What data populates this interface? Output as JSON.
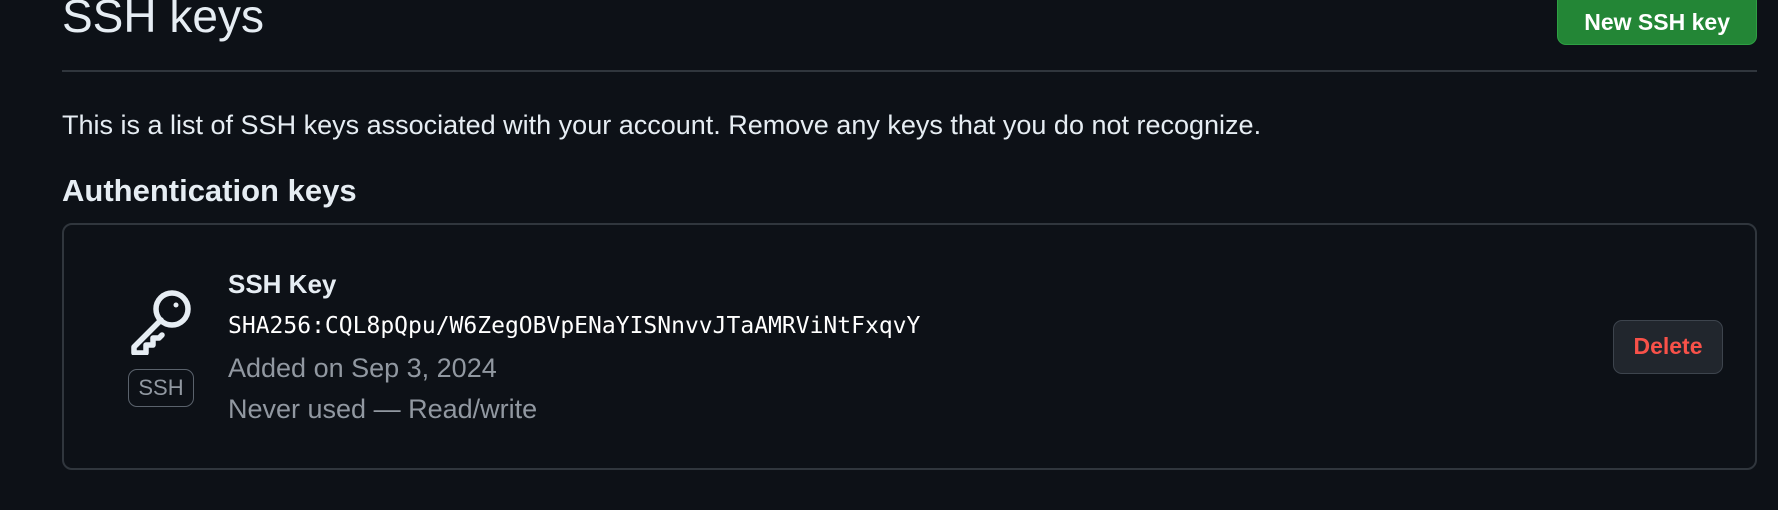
{
  "header": {
    "title": "SSH keys",
    "new_key_label": "New SSH key"
  },
  "description": "This is a list of SSH keys associated with your account. Remove any keys that you do not recognize.",
  "section": {
    "title": "Authentication keys"
  },
  "keys": [
    {
      "icon": "key-icon",
      "type_badge": "SSH",
      "title": "SSH Key",
      "fingerprint": "SHA256:CQL8pQpu/W6ZegOBVpENaYISNnvvJTaAMRViNtFxqvY",
      "added": "Added on Sep 3, 2024",
      "usage": "Never used — Read/write",
      "delete_label": "Delete"
    }
  ],
  "colors": {
    "background": "#0d1117",
    "border": "#30363d",
    "primary_button": "#238636",
    "danger_text": "#f85149",
    "muted_text": "#9198a1"
  }
}
